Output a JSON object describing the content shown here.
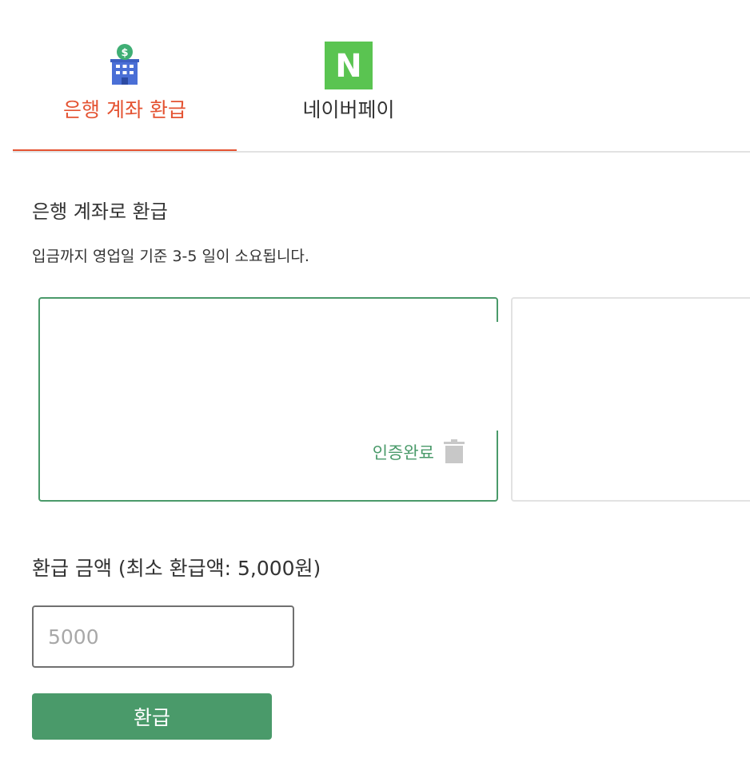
{
  "tabs": [
    {
      "label": "은행 계좌 환급",
      "icon": "bank-building-icon",
      "active": true
    },
    {
      "label": "네이버페이",
      "icon": "naver-n-icon",
      "active": false
    }
  ],
  "bank_icon_symbol": "$",
  "naver_icon_letter": "N",
  "section": {
    "title": "은행 계좌로 환급",
    "description": "입금까지 영업일 기준 3-5 일이 소요됩니다."
  },
  "account_card": {
    "status": "인증완료",
    "delete_icon": "trash-icon"
  },
  "amount": {
    "label": "환급 금액 (최소 환급액: 5,000원)",
    "placeholder": "5000"
  },
  "refund_button": {
    "label": "환급"
  },
  "colors": {
    "accent_red": "#e45332",
    "brand_green": "#4a9a6a",
    "naver_green": "#5ac451",
    "bank_blue": "#4a6fd6"
  }
}
